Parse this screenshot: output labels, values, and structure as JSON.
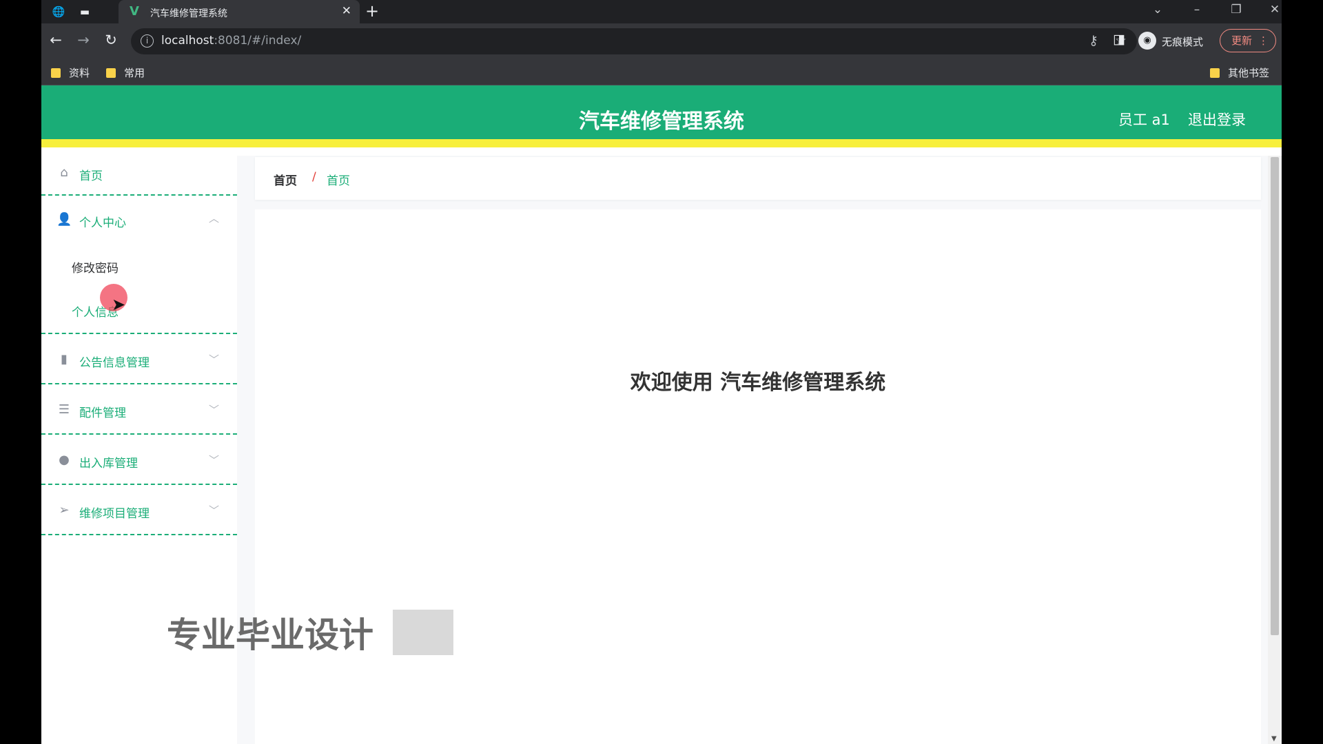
{
  "browser": {
    "tab_title": "汽车维修管理系统",
    "url_host": "localhost",
    "url_rest": ":8081/#/index/",
    "incognito_label": "无痕模式",
    "update_label": "更新",
    "bookmarks": [
      "资料",
      "常用"
    ],
    "other_bookmarks": "其他书签"
  },
  "header": {
    "title": "汽车维修管理系统",
    "user": "员工 a1",
    "logout": "退出登录"
  },
  "sidebar": {
    "home": "首页",
    "personal_center": "个人中心",
    "personal_sub": [
      "修改密码",
      "个人信息"
    ],
    "items": [
      "公告信息管理",
      "配件管理",
      "出入库管理",
      "维修项目管理"
    ]
  },
  "breadcrumb": {
    "home": "首页",
    "separator": "/",
    "current": "首页"
  },
  "main": {
    "welcome": "欢迎使用 汽车维修管理系统"
  },
  "watermark": "专业毕业设计",
  "colors": {
    "primary": "#1aad77",
    "accent_stripe": "#f7ef3c",
    "breadcrumb_sep": "#e2403a"
  }
}
